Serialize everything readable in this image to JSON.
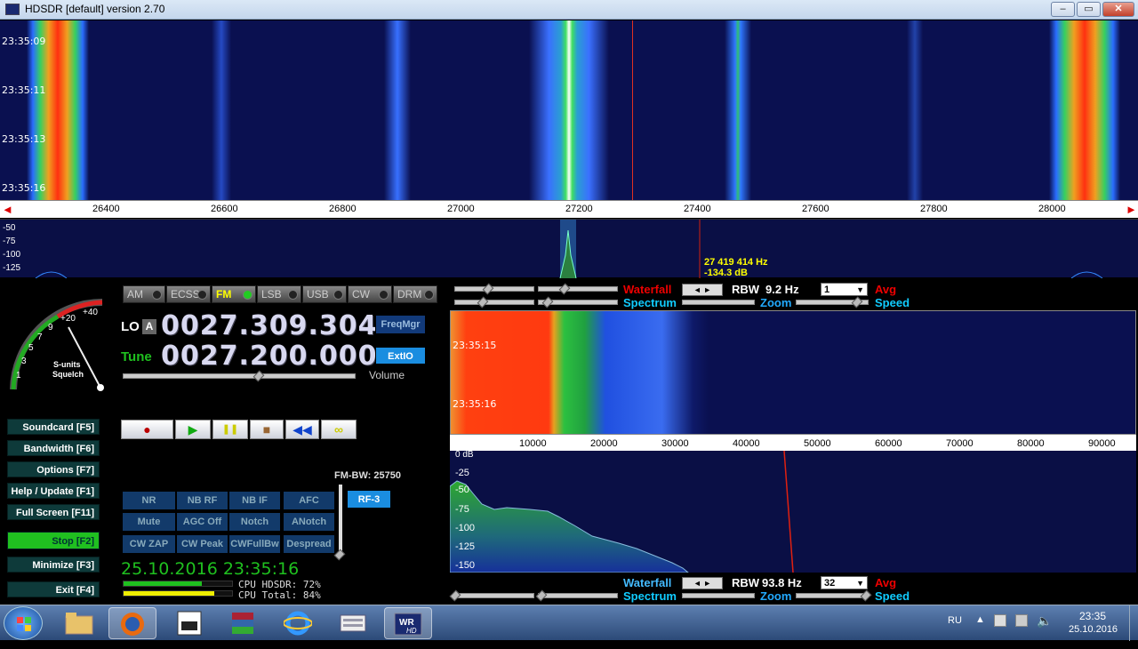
{
  "window": {
    "title": "HDSDR [default]  version 2.70",
    "min_glyph": "–",
    "max_glyph": "▭",
    "close_glyph": "✕"
  },
  "waterfall_top": {
    "timestamps": [
      "23:35:09",
      "23:35:11",
      "23:35:13",
      "23:35:16"
    ]
  },
  "freq_axis_top": {
    "labels": [
      "26400",
      "26600",
      "26800",
      "27000",
      "27200",
      "27400",
      "27600",
      "27800",
      "28000"
    ],
    "left_arrow": "◄",
    "right_arrow": "►"
  },
  "spectrum_top": {
    "db_labels": [
      "-50",
      "-75",
      "-100",
      "-125"
    ],
    "cursor_freq": "27 419 414 Hz",
    "cursor_level": "-134.3 dB"
  },
  "modes": [
    {
      "label": "AM",
      "active": false
    },
    {
      "label": "ECSS",
      "active": false
    },
    {
      "label": "FM",
      "active": true
    },
    {
      "label": "LSB",
      "active": false
    },
    {
      "label": "USB",
      "active": false
    },
    {
      "label": "CW",
      "active": false
    },
    {
      "label": "DRM",
      "active": false
    }
  ],
  "smeter": {
    "scale": [
      "1",
      "3",
      "5",
      "7",
      "9",
      "+20",
      "+40"
    ],
    "label1": "S-units",
    "label2": "Squelch"
  },
  "lo": {
    "label": "LO",
    "a_label": "A",
    "value": "0027.309.304"
  },
  "tune": {
    "label": "Tune",
    "value": "0027.200.000"
  },
  "buttons": {
    "freqmgr": "FreqMgr",
    "extio": "ExtIO",
    "volume": "Volume"
  },
  "transport": [
    "●",
    "▶",
    "❚❚",
    "■",
    "◀◀",
    "∞"
  ],
  "side_buttons": [
    {
      "label": "Soundcard  [F5]"
    },
    {
      "label": "Bandwidth  [F6]"
    },
    {
      "label": "Options  [F7]"
    },
    {
      "label": "Help / Update  [F1]"
    },
    {
      "label": "Full Screen  [F11]"
    },
    {
      "label": "Stop          [F2]"
    },
    {
      "label": "Minimize  [F3]"
    },
    {
      "label": "Exit       [F4]"
    }
  ],
  "fm_bw": "FM-BW: 25750",
  "rf_button": "RF-3",
  "dsp_row1": [
    "NR",
    "NB RF",
    "NB IF",
    "AFC"
  ],
  "dsp_row2": [
    "Mute",
    "AGC Off",
    "Notch",
    "ANotch"
  ],
  "dsp_row3": [
    "CW ZAP",
    "CW Peak",
    "CWFullBw",
    "Despread"
  ],
  "datetime": "25.10.2016 23:35:16",
  "cpu": {
    "hdsdr_label": "CPU HDSDR: 72%",
    "total_label": "CPU Total: 84%",
    "hdsdr_value": 0.72,
    "total_value": 0.84
  },
  "top_controls": {
    "waterfall": "Waterfall",
    "spectrum": "Spectrum",
    "rbw_label": "RBW",
    "rbw_value": "9.2 Hz",
    "avg_combo": "1",
    "avg": "Avg",
    "zoom": "Zoom",
    "speed": "Speed"
  },
  "waterfall_bottom": {
    "timestamps": [
      "23:35:15",
      "23:35:16"
    ]
  },
  "freq_axis_bottom": {
    "labels": [
      "10000",
      "20000",
      "30000",
      "40000",
      "50000",
      "60000",
      "70000",
      "80000",
      "90000"
    ]
  },
  "spectrum_bottom": {
    "db_labels": [
      "0 dB",
      "-25",
      "-50",
      "-75",
      "-100",
      "-125",
      "-150"
    ]
  },
  "bottom_controls": {
    "waterfall": "Waterfall",
    "spectrum": "Spectrum",
    "rbw_label": "RBW",
    "rbw_value": "93.8 Hz",
    "avg_combo": "32",
    "avg": "Avg",
    "zoom": "Zoom",
    "speed": "Speed"
  },
  "taskbar": {
    "lang": "RU",
    "time": "23:35",
    "date": "25.10.2016"
  }
}
